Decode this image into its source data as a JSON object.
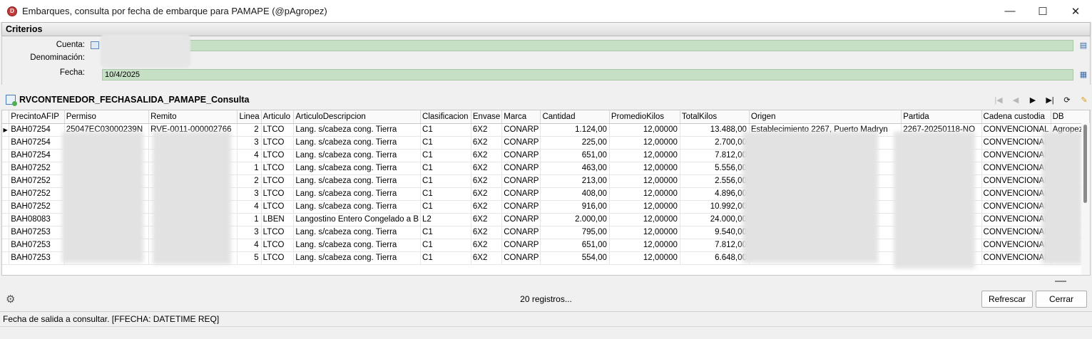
{
  "window": {
    "title": "Embarques, consulta por fecha de embarque para PAMAPE (@pAgropez)",
    "minimize": "—",
    "maximize": "☐",
    "close": "✕"
  },
  "criterios": {
    "header": "Criterios",
    "cuenta_label": "Cuenta:",
    "denominacion_label": "Denominación:",
    "fecha_label": "Fecha:",
    "fecha_value": "10/4/2025"
  },
  "grid": {
    "title": "RVCONTENEDOR_FECHASALIDA_PAMAPE_Consulta",
    "columns": [
      "PrecintoAFIP",
      "Permiso",
      "Remito",
      "Linea",
      "Articulo",
      "ArticuloDescripcion",
      "Clasificacion",
      "Envase",
      "Marca",
      "Cantidad",
      "PromedioKilos",
      "TotalKilos",
      "Origen",
      "Partida",
      "Cadena custodia",
      "DB"
    ],
    "rows": [
      [
        "BAH07254",
        "25047EC03000239N",
        "RVE-0011-000002766",
        "2",
        "LTCO",
        "Lang. s/cabeza cong. Tierra",
        "C1",
        "6X2",
        "CONARP",
        "1.124,00",
        "12,00000",
        "13.488,00",
        "Establecimiento 2267, Puerto Madryn",
        "2267-20250118-NO",
        "CONVENCIONAL",
        "Agropez"
      ],
      [
        "BAH07254",
        "",
        "",
        "3",
        "LTCO",
        "Lang. s/cabeza cong. Tierra",
        "C1",
        "6X2",
        "CONARP",
        "225,00",
        "12,00000",
        "2.700,00",
        "",
        "",
        "CONVENCIONAL",
        ""
      ],
      [
        "BAH07254",
        "",
        "",
        "4",
        "LTCO",
        "Lang. s/cabeza cong. Tierra",
        "C1",
        "6X2",
        "CONARP",
        "651,00",
        "12,00000",
        "7.812,00",
        "",
        "",
        "CONVENCIONAL",
        ""
      ],
      [
        "BAH07252",
        "",
        "",
        "1",
        "LTCO",
        "Lang. s/cabeza cong. Tierra",
        "C1",
        "6X2",
        "CONARP",
        "463,00",
        "12,00000",
        "5.556,00",
        "",
        "",
        "CONVENCIONAL",
        ""
      ],
      [
        "BAH07252",
        "",
        "",
        "2",
        "LTCO",
        "Lang. s/cabeza cong. Tierra",
        "C1",
        "6X2",
        "CONARP",
        "213,00",
        "12,00000",
        "2.556,00",
        "",
        "",
        "CONVENCIONAL",
        ""
      ],
      [
        "BAH07252",
        "",
        "",
        "3",
        "LTCO",
        "Lang. s/cabeza cong. Tierra",
        "C1",
        "6X2",
        "CONARP",
        "408,00",
        "12,00000",
        "4.896,00",
        "",
        "",
        "CONVENCIONAL",
        ""
      ],
      [
        "BAH07252",
        "",
        "",
        "4",
        "LTCO",
        "Lang. s/cabeza cong. Tierra",
        "C1",
        "6X2",
        "CONARP",
        "916,00",
        "12,00000",
        "10.992,00",
        "",
        "",
        "CONVENCIONAL",
        ""
      ],
      [
        "BAH08083",
        "",
        "",
        "1",
        "LBEN",
        "Langostino Entero Congelado a B",
        "L2",
        "6X2",
        "CONARP",
        "2.000,00",
        "12,00000",
        "24.000,00",
        "",
        "",
        "CONVENCIONAL",
        ""
      ],
      [
        "BAH07253",
        "",
        "",
        "3",
        "LTCO",
        "Lang. s/cabeza cong. Tierra",
        "C1",
        "6X2",
        "CONARP",
        "795,00",
        "12,00000",
        "9.540,00",
        "",
        "",
        "CONVENCIONAL",
        ""
      ],
      [
        "BAH07253",
        "",
        "",
        "4",
        "LTCO",
        "Lang. s/cabeza cong. Tierra",
        "C1",
        "6X2",
        "CONARP",
        "651,00",
        "12,00000",
        "7.812,00",
        "",
        "",
        "CONVENCIONAL",
        ""
      ],
      [
        "BAH07253",
        "",
        "",
        "5",
        "LTCO",
        "Lang. s/cabeza cong. Tierra",
        "C1",
        "6X2",
        "CONARP",
        "554,00",
        "12,00000",
        "6.648,00",
        "",
        "",
        "CONVENCIONAL",
        ""
      ]
    ]
  },
  "footer": {
    "registros": "20 registros...",
    "refrescar": "Refrescar",
    "cerrar": "Cerrar"
  },
  "status": "Fecha de salida a consultar. [FFECHA: DATETIME REQ]",
  "colors": {
    "field_bg": "#c6e0c6",
    "header_bg": "#dcdcdc"
  }
}
